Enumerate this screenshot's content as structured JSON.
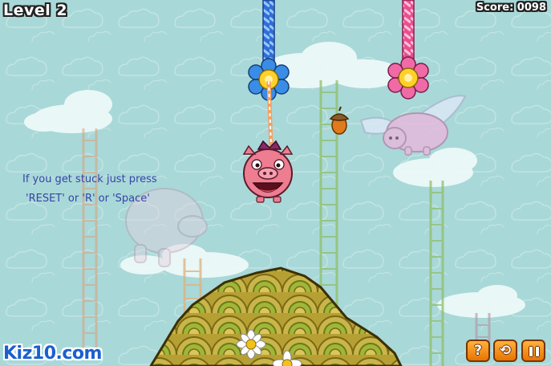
{
  "hud": {
    "level": "Level 2",
    "score": "Score: 0098"
  },
  "hint": {
    "line1": "If you get stuck just press",
    "line2": "'RESET' or 'R' or 'Space'"
  },
  "brand": {
    "name": "Kiz10.com"
  },
  "controls": {
    "help_icon": "help-icon",
    "help_glyph": "?",
    "reset_icon": "reset-icon",
    "reset_glyph": "⟲",
    "pause_icon": "pause-icon",
    "pause_glyph": "❚❚"
  },
  "colors": {
    "sky": "#a9d8d8",
    "hint_text": "#3545a8",
    "brand": "#1b5fcf",
    "button": "#f08a12",
    "blue_rope": "#2f6fd6",
    "pink_rope": "#e8508f"
  }
}
